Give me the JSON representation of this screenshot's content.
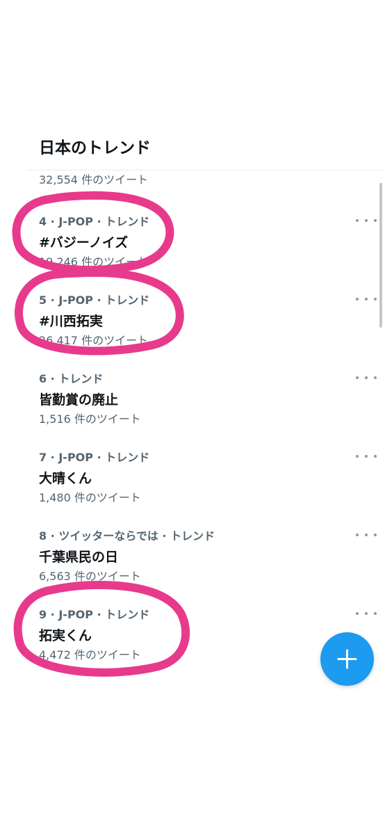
{
  "header": {
    "title": "日本のトレンド"
  },
  "top_partial_count": "32,554 件のツイート",
  "trends": [
    {
      "meta": "4 · J-POP · トレンド",
      "name": "#バジーノイズ",
      "tweets": "19,246 件のツイート"
    },
    {
      "meta": "5 · J-POP · トレンド",
      "name": "#川西拓実",
      "tweets": "26,417 件のツイート"
    },
    {
      "meta": "6 · トレンド",
      "name": "皆勤賞の廃止",
      "tweets": "1,516 件のツイート"
    },
    {
      "meta": "7 · J-POP · トレンド",
      "name": "大晴くん",
      "tweets": "1,480 件のツイート"
    },
    {
      "meta": "8 · ツイッターならでは · トレンド",
      "name": "千葉県民の日",
      "tweets": "6,563 件のツイート"
    },
    {
      "meta": "9 · J-POP · トレンド",
      "name": "拓実くん",
      "tweets": "4,472 件のツイート"
    }
  ],
  "icons": {
    "more": "more-horizontal-icon",
    "compose": "plus-icon"
  },
  "colors": {
    "accent": "#1d9bf0",
    "annotation": "#e83a8c",
    "secondary_text": "#536471",
    "primary_text": "#0f1419"
  }
}
